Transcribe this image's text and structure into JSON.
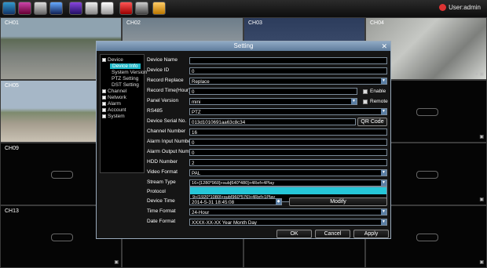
{
  "user": {
    "label": "User:admin"
  },
  "toolbar": {
    "icons": [
      "record-icon",
      "playback-icon",
      "network-icon",
      "video-play-icon",
      "files-icon",
      "camera-roll-icon",
      "alarm-icon",
      "snapshot-icon",
      "folder-icon"
    ]
  },
  "cameras": [
    {
      "label": "CH01"
    },
    {
      "label": "CH02"
    },
    {
      "label": "CH03"
    },
    {
      "label": "CH04"
    },
    {
      "label": "CH05"
    },
    {
      "label": "CH09"
    },
    {
      "label": "CH13"
    }
  ],
  "dialog": {
    "title": "Setting",
    "tree": {
      "device": "Device",
      "device_info": "Device Info",
      "system_version": "System Version",
      "ptz_setting": "PTZ Setting",
      "dst_setting": "DST Setting",
      "channel": "Channel",
      "network": "Network",
      "alarm": "Alarm",
      "account": "Account",
      "system": "System"
    },
    "fields": {
      "device_name": {
        "label": "Device Name",
        "value": ""
      },
      "device_id": {
        "label": "Device ID",
        "value": "0"
      },
      "record_replace": {
        "label": "Record Replace",
        "value": "Replace"
      },
      "record_time": {
        "label": "Record Time(Hour)",
        "value": "0",
        "check_label": "Enable"
      },
      "panel_version": {
        "label": "Panel Version",
        "value": "mini",
        "check_label": "Remote"
      },
      "rs485": {
        "label": "RS485",
        "value": "PTZ"
      },
      "serial": {
        "label": "Device Serial No.",
        "value": "013d1010691aa63c8c34",
        "button": "QR Code"
      },
      "channel_number": {
        "label": "Channel Number",
        "value": "16"
      },
      "alarm_input": {
        "label": "Alarm Input Number",
        "value": "0"
      },
      "alarm_output": {
        "label": "Alarm Output Number",
        "value": "0"
      },
      "hdd_number": {
        "label": "HDD Number",
        "value": "2"
      },
      "video_format": {
        "label": "Video Format",
        "value": "PAL"
      },
      "stream_type": {
        "label": "Stream Type",
        "value": "16+[1280*960]+sub[640*480]+4Ref+4Play"
      },
      "protocol": {
        "label": "Protocol"
      },
      "device_time": {
        "label": "Device Time",
        "value": "2014-5-31 18:45:08",
        "button": "Modify"
      },
      "time_format": {
        "label": "Time Format",
        "value": "24-Hour"
      },
      "date_format": {
        "label": "Date Format",
        "value": "XXXX-XX-XX Year Month Day"
      }
    },
    "stream_options": [
      "",
      "9+[1920*1080]+sub[960*576]+4Ref+1Play"
    ],
    "buttons": {
      "ok": "OK",
      "cancel": "Cancel",
      "apply": "Apply"
    }
  }
}
